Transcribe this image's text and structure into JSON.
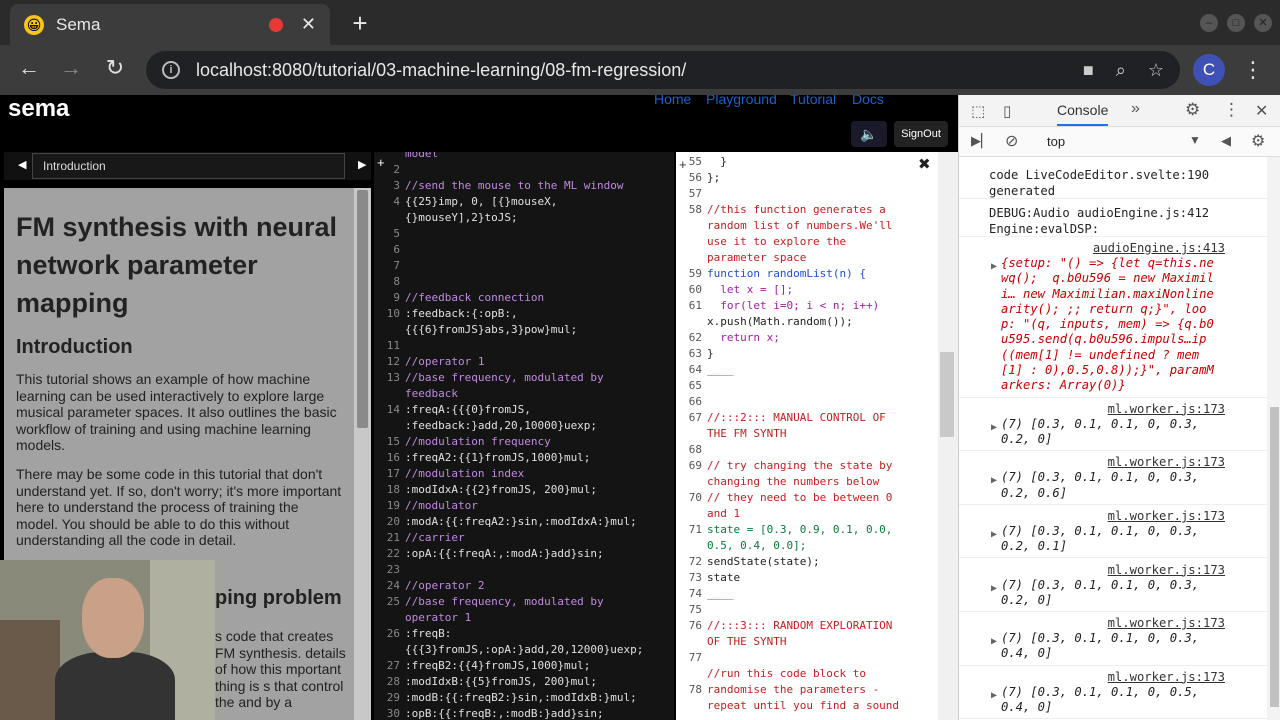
{
  "browser": {
    "tab_title": "Sema",
    "favicon": "😀",
    "new_tab": "+",
    "tab_close": "✕",
    "url": "localhost:8080/tutorial/03-machine-learning/08-fm-regression/",
    "avatar_letter": "C"
  },
  "app": {
    "logo": "sema",
    "nav": [
      "Home",
      "Playground",
      "Tutorial",
      "Docs"
    ],
    "signout": "SignOut",
    "mute_icon": "🔈"
  },
  "tutorial": {
    "selected": "Introduction",
    "title": "FM synthesis with neural network parameter mapping",
    "h2_intro": "Introduction",
    "p1": "This tutorial shows an example of how machine learning can be used interactively to explore large musical parameter spaces. It also outlines the basic workflow of training and using machine learning models.",
    "p2": "There may be some code in this tutorial that don't understand yet. If so, don't worry; it's more important here to understand the process of training the model. You should be able to do this without understanding all the code in detail.",
    "h2_problem": "ping problem",
    "p3": "s code that creates FM synthesis. details of how this mportant thing is s that control the and by a"
  },
  "editor1": {
    "lines": [
      {
        "n": "",
        "t": "model",
        "c": "com"
      },
      {
        "n": "2",
        "t": "",
        "c": "tx"
      },
      {
        "n": "3",
        "t": "//send the mouse to the ML window",
        "c": "com"
      },
      {
        "n": "4",
        "t": "{{25}imp, 0, [{}mouseX,",
        "c": "tx"
      },
      {
        "n": "",
        "t": "{}mouseY],2}toJS;",
        "c": "tx"
      },
      {
        "n": "5",
        "t": "",
        "c": "tx"
      },
      {
        "n": "6",
        "t": "",
        "c": "tx"
      },
      {
        "n": "7",
        "t": "",
        "c": "tx"
      },
      {
        "n": "8",
        "t": "",
        "c": "tx"
      },
      {
        "n": "9",
        "t": "//feedback connection",
        "c": "com"
      },
      {
        "n": "10",
        "t": ":feedback:{:opB:,",
        "c": "tx"
      },
      {
        "n": "",
        "t": "{{{6}fromJS}abs,3}pow}mul;",
        "c": "tx"
      },
      {
        "n": "11",
        "t": "",
        "c": "tx"
      },
      {
        "n": "12",
        "t": "//operator 1",
        "c": "com"
      },
      {
        "n": "13",
        "t": "//base frequency, modulated by",
        "c": "com"
      },
      {
        "n": "",
        "t": "feedback",
        "c": "com"
      },
      {
        "n": "14",
        "t": ":freqA:{{{0}fromJS,",
        "c": "tx"
      },
      {
        "n": "",
        "t": ":feedback:}add,20,10000}uexp;",
        "c": "tx"
      },
      {
        "n": "15",
        "t": "//modulation frequency",
        "c": "com"
      },
      {
        "n": "16",
        "t": ":freqA2:{{1}fromJS,1000}mul;",
        "c": "tx"
      },
      {
        "n": "17",
        "t": "//modulation index",
        "c": "com"
      },
      {
        "n": "18",
        "t": ":modIdxA:{{2}fromJS, 200}mul;",
        "c": "tx"
      },
      {
        "n": "19",
        "t": "//modulator",
        "c": "com"
      },
      {
        "n": "20",
        "t": ":modA:{{:freqA2:}sin,:modIdxA:}mul;",
        "c": "tx"
      },
      {
        "n": "21",
        "t": "//carrier",
        "c": "com"
      },
      {
        "n": "22",
        "t": ":opA:{{:freqA:,:modA:}add}sin;",
        "c": "tx"
      },
      {
        "n": "23",
        "t": "",
        "c": "tx"
      },
      {
        "n": "24",
        "t": "//operator 2",
        "c": "com"
      },
      {
        "n": "25",
        "t": "//base frequency, modulated by",
        "c": "com"
      },
      {
        "n": "",
        "t": "operator 1",
        "c": "com"
      },
      {
        "n": "26",
        "t": ":freqB:",
        "c": "tx"
      },
      {
        "n": "",
        "t": "{{{3}fromJS,:opA:}add,20,12000}uexp;",
        "c": "tx"
      },
      {
        "n": "27",
        "t": ":freqB2:{{4}fromJS,1000}mul;",
        "c": "tx"
      },
      {
        "n": "28",
        "t": ":modIdxB:{{5}fromJS, 200}mul;",
        "c": "tx"
      },
      {
        "n": "29",
        "t": ":modB:{{:freqB2:}sin,:modIdxB:}mul;",
        "c": "tx"
      },
      {
        "n": "30",
        "t": ":opB:{{:freqB:,:modB:}add}sin;",
        "c": "tx"
      }
    ]
  },
  "editor2": {
    "lines": [
      {
        "n": "55",
        "t": "  }",
        "c": "tx"
      },
      {
        "n": "56",
        "t": "};",
        "c": "tx"
      },
      {
        "n": "57",
        "t": "",
        "c": "tx"
      },
      {
        "n": "58",
        "t": "//this function generates a",
        "c": "com"
      },
      {
        "n": "",
        "t": "random list of numbers.We'll",
        "c": "com"
      },
      {
        "n": "",
        "t": "use it to explore the",
        "c": "com"
      },
      {
        "n": "",
        "t": "parameter space",
        "c": "com"
      },
      {
        "n": "59",
        "t": "function randomList(n) {",
        "c": "fn"
      },
      {
        "n": "60",
        "t": "  let x = [];",
        "c": "kw"
      },
      {
        "n": "61",
        "t": "  for(let i=0; i < n; i++)",
        "c": "kw"
      },
      {
        "n": "",
        "t": "x.push(Math.random());",
        "c": "tx"
      },
      {
        "n": "62",
        "t": "  return x;",
        "c": "kw"
      },
      {
        "n": "63",
        "t": "}",
        "c": "tx"
      },
      {
        "n": "64",
        "t": "____",
        "c": "com"
      },
      {
        "n": "65",
        "t": "",
        "c": "tx"
      },
      {
        "n": "66",
        "t": "",
        "c": "tx"
      },
      {
        "n": "67",
        "t": "//:::2::: MANUAL CONTROL OF",
        "c": "com"
      },
      {
        "n": "",
        "t": "THE FM SYNTH",
        "c": "com"
      },
      {
        "n": "68",
        "t": "",
        "c": "tx"
      },
      {
        "n": "69",
        "t": "// try changing the state by",
        "c": "com"
      },
      {
        "n": "",
        "t": "changing the numbers below",
        "c": "com"
      },
      {
        "n": "70",
        "t": "// they need to be between 0",
        "c": "com"
      },
      {
        "n": "",
        "t": "and 1",
        "c": "com"
      },
      {
        "n": "71",
        "t": "state = [0.3, 0.9, 0.1, 0.0,",
        "c": "num"
      },
      {
        "n": "",
        "t": "0.5, 0.4, 0.0];",
        "c": "num"
      },
      {
        "n": "72",
        "t": "sendState(state);",
        "c": "tx"
      },
      {
        "n": "73",
        "t": "state",
        "c": "tx"
      },
      {
        "n": "74",
        "t": "____",
        "c": "com"
      },
      {
        "n": "75",
        "t": "",
        "c": "tx"
      },
      {
        "n": "76",
        "t": "//:::3::: RANDOM EXPLORATION",
        "c": "com"
      },
      {
        "n": "",
        "t": "OF THE SYNTH",
        "c": "com"
      },
      {
        "n": "77",
        "t": "",
        "c": "tx"
      },
      {
        "n": "",
        "t": "//run this code block to",
        "c": "com"
      },
      {
        "n": "78",
        "t": "randomise the parameters -",
        "c": "com"
      },
      {
        "n": "",
        "t": "repeat until you find a sound",
        "c": "com"
      }
    ]
  },
  "devtools": {
    "tab_console": "Console",
    "context": "top",
    "messages": [
      {
        "text": "code LiveCodeEditor.svelte:190\ngenerated",
        "src": ""
      },
      {
        "text": "DEBUG:Audio audioEngine.js:412\nEngine:evalDSP:",
        "src": ""
      },
      {
        "src": "audioEngine.js:413",
        "obj": "{setup: \"() => {let q=this.ne\nwq();  q.b0u596 = new Maximil\ni… new Maximilian.maxiNonline\narity(); ;; return q;}\", loo\np: \"(q, inputs, mem) => {q.b0\nu595.send(q.b0u596.impuls…ip\n((mem[1] != undefined ? mem\n[1] : 0),0.5,0.8));}\", paramM\narkers: Array(0)}"
      },
      {
        "src": "ml.worker.js:173",
        "obj": "(7) [0.3, 0.1, 0.1, 0, 0.3,\n0.2, 0]"
      },
      {
        "src": "ml.worker.js:173",
        "obj": "(7) [0.3, 0.1, 0.1, 0, 0.3,\n0.2, 0.6]"
      },
      {
        "src": "ml.worker.js:173",
        "obj": "(7) [0.3, 0.1, 0.1, 0, 0.3,\n0.2, 0.1]"
      },
      {
        "src": "ml.worker.js:173",
        "obj": "(7) [0.3, 0.1, 0.1, 0, 0.3,\n0.2, 0]"
      },
      {
        "src": "ml.worker.js:173",
        "obj": "(7) [0.3, 0.1, 0.1, 0, 0.3,\n0.4, 0]"
      },
      {
        "src": "ml.worker.js:173",
        "obj": "(7) [0.3, 0.1, 0.1, 0, 0.5,\n0.4, 0]"
      }
    ]
  }
}
